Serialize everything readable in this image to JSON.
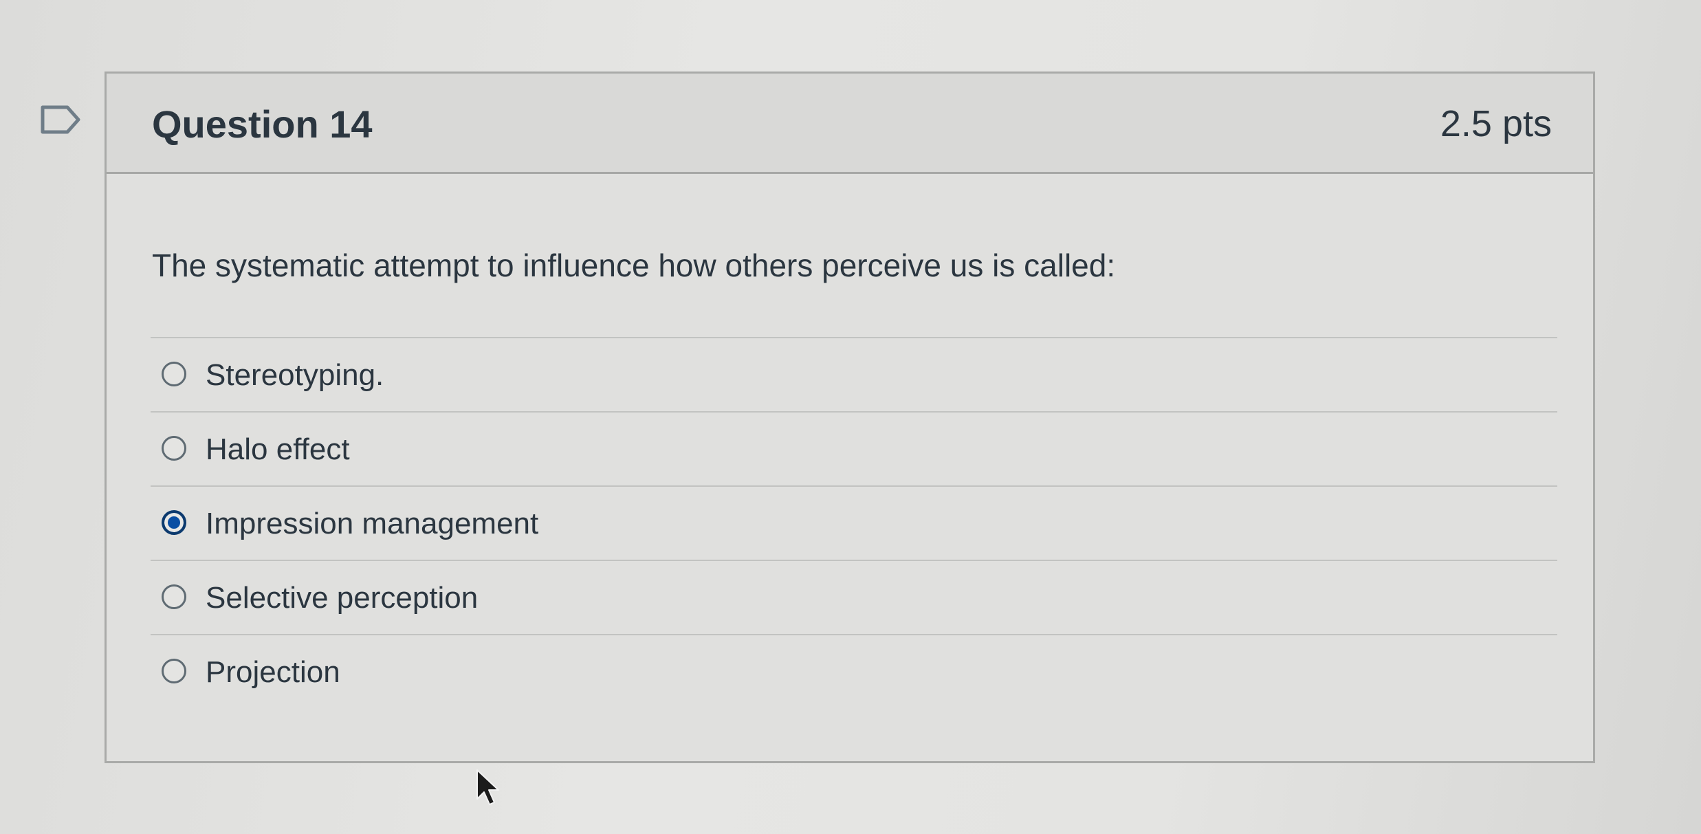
{
  "question": {
    "title": "Question 14",
    "points": "2.5 pts",
    "text": "The systematic attempt to influence how others perceive us is called:",
    "answers": [
      {
        "label": "Stereotyping.",
        "selected": false
      },
      {
        "label": "Halo effect",
        "selected": false
      },
      {
        "label": "Impression management",
        "selected": true
      },
      {
        "label": "Selective perception",
        "selected": false
      },
      {
        "label": "Projection",
        "selected": false
      }
    ]
  },
  "icons": {
    "flag": "flag-question-icon",
    "cursor": "mouse-pointer-icon"
  },
  "colors": {
    "selected_radio": "#0a4ea3",
    "text": "#2b3640"
  }
}
